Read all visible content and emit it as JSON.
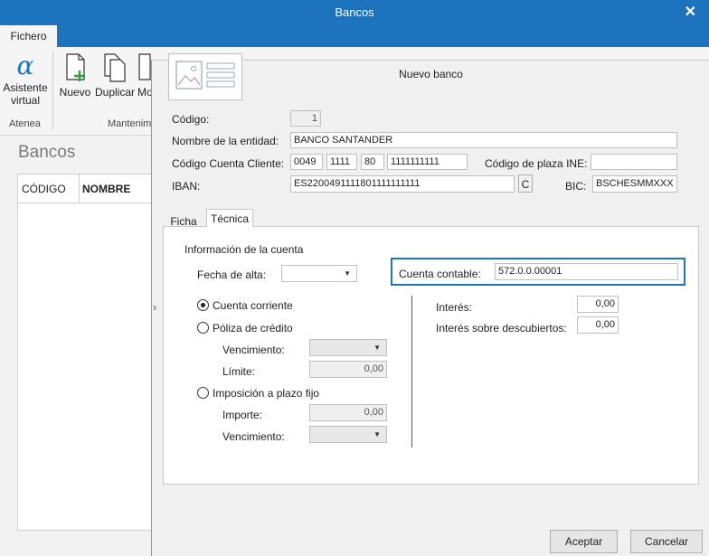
{
  "window": {
    "title": "Bancos",
    "close": "✕"
  },
  "ribbon": {
    "tab": "Fichero",
    "asistente": "Asistente\nvirtual",
    "nuevo": "Nuevo",
    "duplicar": "Duplicar",
    "mod": "Mo",
    "group_atenea": "Atenea",
    "group_mant": "Mantenim"
  },
  "left": {
    "title": "Bancos",
    "col_codigo": "CÓDIGO",
    "col_nombre": "NOMBRE",
    "collapse": "›"
  },
  "dialog": {
    "title": "Nuevo banco",
    "codigo_label": "Código:",
    "codigo_value": "1",
    "nombre_label": "Nombre de la entidad:",
    "nombre_value": "BANCO SANTANDER",
    "ccc_label": "Código Cuenta Cliente:",
    "ccc_1": "0049",
    "ccc_2": "1111",
    "ccc_3": "80",
    "ccc_4": "1111111111",
    "plaza_label": "Código de plaza INE:",
    "plaza_value": "",
    "iban_label": "IBAN:",
    "iban_value": "ES2200491111801111111111",
    "iban_btn": "C",
    "bic_label": "BIC:",
    "bic_value": "BSCHESMMXXX",
    "tab_ficha": "Ficha",
    "tab_tecnica": "Técnica",
    "info_header": "Información de la cuenta",
    "fecha_label": "Fecha de alta:",
    "cuenta_contable_label": "Cuenta contable:",
    "cuenta_contable_value": "572.0.0.00001",
    "radio_corriente": "Cuenta corriente",
    "radio_poliza": "Póliza de crédito",
    "vencimiento_label": "Vencimiento:",
    "limite_label": "Límite:",
    "limite_value": "0,00",
    "radio_imposicion": "Imposición a plazo fijo",
    "importe_label": "Importe:",
    "importe_value": "0,00",
    "vencimiento2_label": "Vencimiento:",
    "interes_label": "Interés:",
    "interes_value": "0,00",
    "interes_desc_label": "Interés sobre descubiertos:",
    "interes_desc_value": "0,00",
    "aceptar": "Aceptar",
    "cancelar": "Cancelar"
  },
  "colors": {
    "accent": "#1e73be",
    "focus": "#1e73be"
  }
}
